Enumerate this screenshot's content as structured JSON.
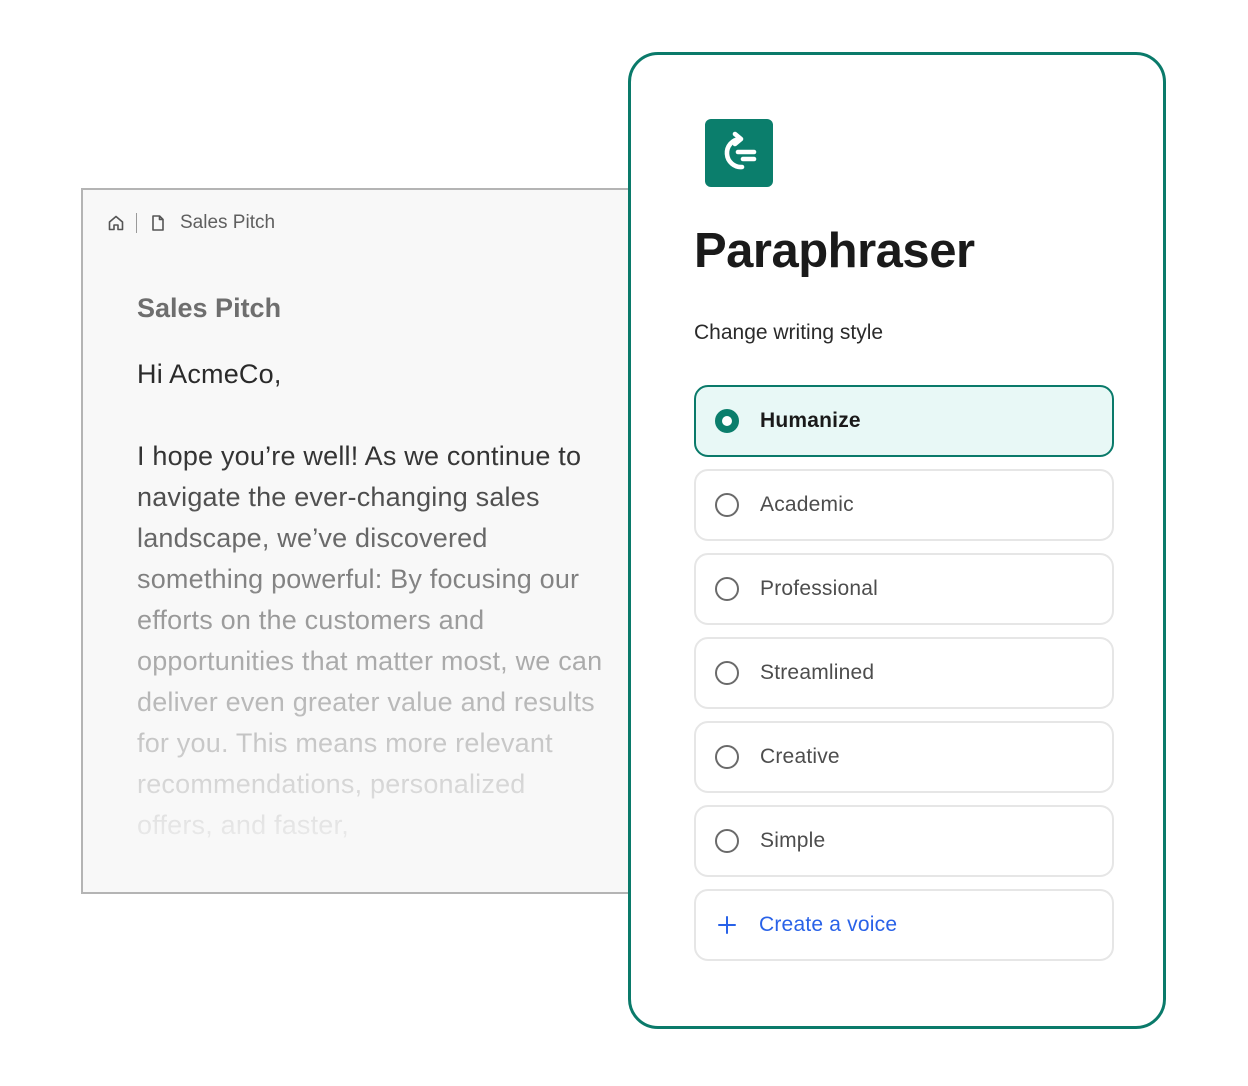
{
  "document": {
    "breadcrumb": {
      "home_icon": "home-icon",
      "file_icon": "file-icon",
      "label": "Sales Pitch"
    },
    "title": "Sales Pitch",
    "greeting": "Hi AcmeCo,",
    "body": "I hope you’re well! As we continue to navigate the ever-changing sales landscape, we’ve discovered something powerful: By focusing our efforts on the customers and opportunities that matter most, we can deliver even greater value and results for you. This means more relevant recommendations, personalized offers, and faster,"
  },
  "paraphraser": {
    "logo_icon": "paraphrase-arrow-icon",
    "title": "Paraphraser",
    "subtitle": "Change writing style",
    "options": [
      {
        "label": "Humanize",
        "selected": true
      },
      {
        "label": "Academic",
        "selected": false
      },
      {
        "label": "Professional",
        "selected": false
      },
      {
        "label": "Streamlined",
        "selected": false
      },
      {
        "label": "Creative",
        "selected": false
      },
      {
        "label": "Simple",
        "selected": false
      }
    ],
    "create_voice": {
      "label": "Create a voice",
      "icon": "plus-icon"
    }
  },
  "colors": {
    "brand": "#0b7e6c",
    "selected_bg": "#e8f8f6",
    "link": "#2962e8"
  }
}
